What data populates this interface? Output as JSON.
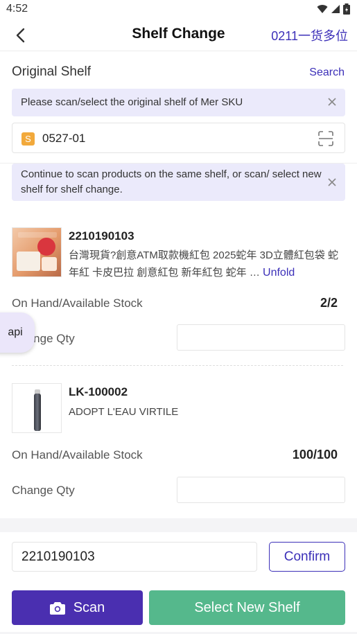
{
  "status_bar": {
    "time": "4:52"
  },
  "navbar": {
    "title": "Shelf Change",
    "action": "0211一货多位"
  },
  "original_shelf": {
    "label": "Original Shelf",
    "search": "Search",
    "hint": "Please scan/select the original shelf of Mer SKU",
    "badge": "S",
    "value": "0527-01"
  },
  "continue_hint": {
    "text": "Continue to scan products on the same shelf, or scan/ select new shelf for shelf change."
  },
  "products": [
    {
      "code": "2210190103",
      "name": "台灣現貨?創意ATM取款機紅包 2025蛇年 3D立體紅包袋 蛇年紅 卡皮巴拉 創意紅包 新年紅包 蛇年 …",
      "unfold": "Unfold",
      "stock_label": "On Hand/Available Stock",
      "stock_value": "2/2",
      "qty_label": "Change Qty",
      "qty_value": ""
    },
    {
      "code": "LK-100002",
      "name": "ADOPT L'EAU VIRTILE",
      "stock_label": "On Hand/Available Stock",
      "stock_value": "100/100",
      "qty_label": "Change Qty",
      "qty_value": ""
    }
  ],
  "api_bubble": "api",
  "bottom": {
    "code_value": "2210190103",
    "confirm": "Confirm",
    "scan": "Scan",
    "select_new_shelf": "Select New Shelf"
  },
  "colors": {
    "accent": "#3b2fb8",
    "scan_button": "#4a2fb0",
    "select_button": "#55b88c",
    "hint_bg": "#ebeafb",
    "badge": "#f2a93b"
  },
  "icons": [
    "wifi-icon",
    "signal-icon",
    "battery-icon",
    "back-arrow-icon",
    "close-icon",
    "scan-frame-icon",
    "camera-icon"
  ]
}
